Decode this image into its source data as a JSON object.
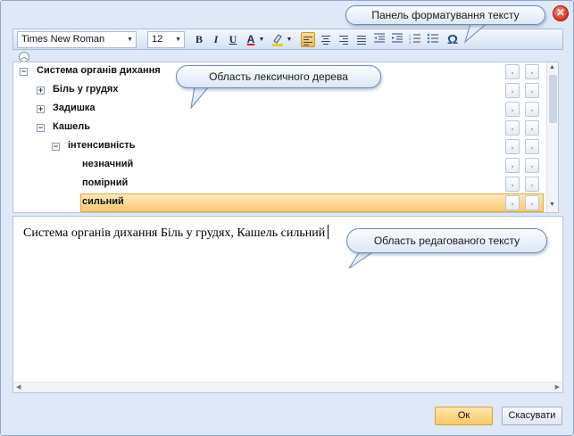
{
  "toolbar": {
    "font_family": "Times New Roman",
    "font_size": "12",
    "bold": "B",
    "italic": "I",
    "underline": "U",
    "font_color": "A",
    "special_char": "Ω"
  },
  "tree": {
    "items": [
      {
        "label": "Система органів дихання",
        "expander": "−",
        "level": 0
      },
      {
        "label": "Біль у грудях",
        "expander": "+",
        "level": 1
      },
      {
        "label": "Задишка",
        "expander": "+",
        "level": 1
      },
      {
        "label": "Кашель",
        "expander": "−",
        "level": 1
      },
      {
        "label": "інтенсивність",
        "expander": "−",
        "level": 2
      },
      {
        "label": "незначний",
        "expander": "",
        "level": 3
      },
      {
        "label": "помірний",
        "expander": "",
        "level": 3
      },
      {
        "label": "сильний",
        "expander": "",
        "level": 3,
        "selected": true
      }
    ],
    "row_button_label": ","
  },
  "editor": {
    "text": "Система органів дихання Біль у грудях, Кашель сильний"
  },
  "buttons": {
    "ok": "Ок",
    "cancel": "Скасувати"
  },
  "callouts": {
    "toolbar": "Панель форматування тексту",
    "tree": "Область лексичного дерева",
    "editor": "Область редагованого тексту"
  },
  "colors": {
    "accent_selection": "#f9c96e",
    "window_bg": "#dfe8f6",
    "close_button": "#d8331f"
  }
}
